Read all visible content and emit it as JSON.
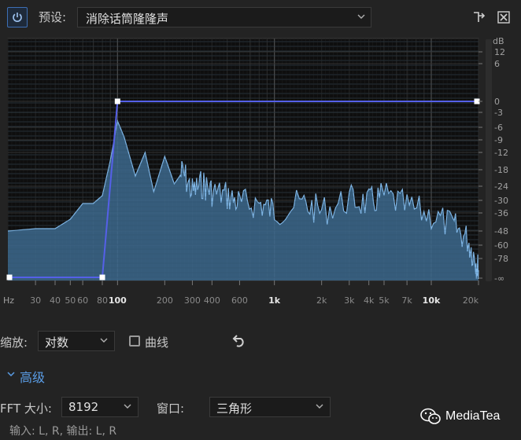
{
  "toolbar": {
    "preset_label": "预设:",
    "preset_value": "消除话筒隆隆声"
  },
  "graph": {
    "db_axis": {
      "unit": "dB",
      "ticks": [
        "12",
        "6",
        "0",
        "-3",
        "-6",
        "-9",
        "-12",
        "-18",
        "-24",
        "-30",
        "-36",
        "-48",
        "-60",
        "-78",
        "-∞"
      ]
    },
    "freq_axis": {
      "unit": "Hz",
      "ticks": [
        "30",
        "40",
        "50",
        "60",
        "80",
        "100",
        "200",
        "300",
        "400",
        "600",
        "1k",
        "2k",
        "3k",
        "4k",
        "5k",
        "7k",
        "10k",
        "20k"
      ]
    },
    "eq_curve_points": [
      {
        "freq_hz": 20,
        "db": "-∞"
      },
      {
        "freq_hz": 80,
        "db": "-∞"
      },
      {
        "freq_hz": 100,
        "db": 0
      },
      {
        "freq_hz": 20000,
        "db": 0
      }
    ],
    "colors": {
      "background": "#0e0e0e",
      "spectrum_fill": "#3d6a8e",
      "spectrum_line": "#7fb6e6",
      "eq_line": "#5560e8",
      "handle": "#ffffff"
    }
  },
  "controls": {
    "zoom_label": "缩放:",
    "zoom_value": "对数",
    "curve_label": "曲线",
    "curve_checked": false,
    "advanced_label": "高级",
    "fft_label": "FFT 大小:",
    "fft_value": "8192",
    "window_label": "窗口:",
    "window_value": "三角形",
    "io_text": "输入: L, R,  输出: L, R"
  },
  "watermark": {
    "text": "MediaTea"
  }
}
